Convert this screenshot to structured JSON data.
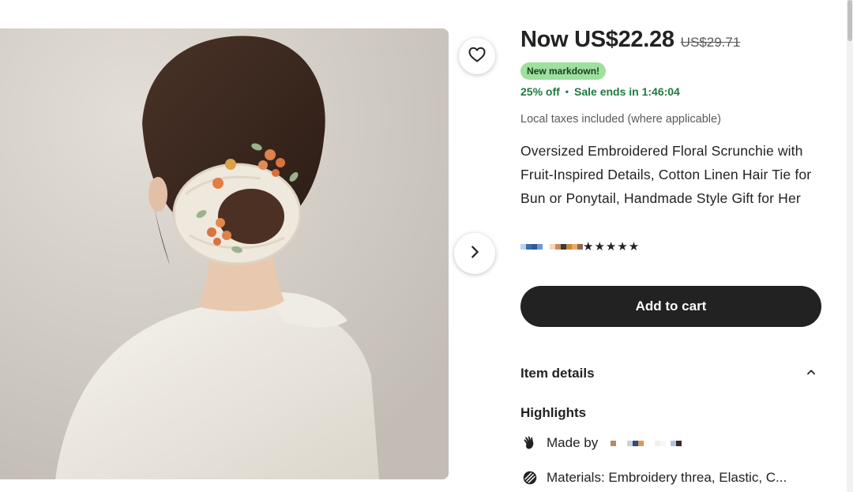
{
  "gallery": {
    "image_alt": "Woman from behind wearing an oversized embroidered floral scrunchie in a low bun",
    "favorite_icon": "heart-outline-icon",
    "next_icon": "chevron-right-icon"
  },
  "pricing": {
    "now": "Now US$22.28",
    "original": "US$29.71",
    "badge": "New markdown!",
    "discount": "25% off",
    "separator": "•",
    "sale_ends": "Sale ends in 1:46:04",
    "taxes_note": "Local taxes included (where applicable)"
  },
  "product": {
    "title": "Oversized Embroidered Floral Scrunchie with Fruit-Inspired Details, Cotton Linen Hair Tie for Bun or Ponytail, Handmade Style Gift for Her",
    "stars": "★★★★★"
  },
  "actions": {
    "add_to_cart": "Add to cart"
  },
  "item_details": {
    "header": "Item details",
    "toggle_icon": "chevron-up-icon",
    "highlights_heading": "Highlights",
    "made_by_label": "Made by",
    "made_by_icon": "hand-wave-icon",
    "materials_text": "Materials: Embroidery threa, Elastic, C...",
    "materials_icon": "thread-spool-icon"
  },
  "colors": {
    "accent_dark": "#222222",
    "sale_green": "#1f7a3f",
    "badge_green": "#9ee09e"
  }
}
